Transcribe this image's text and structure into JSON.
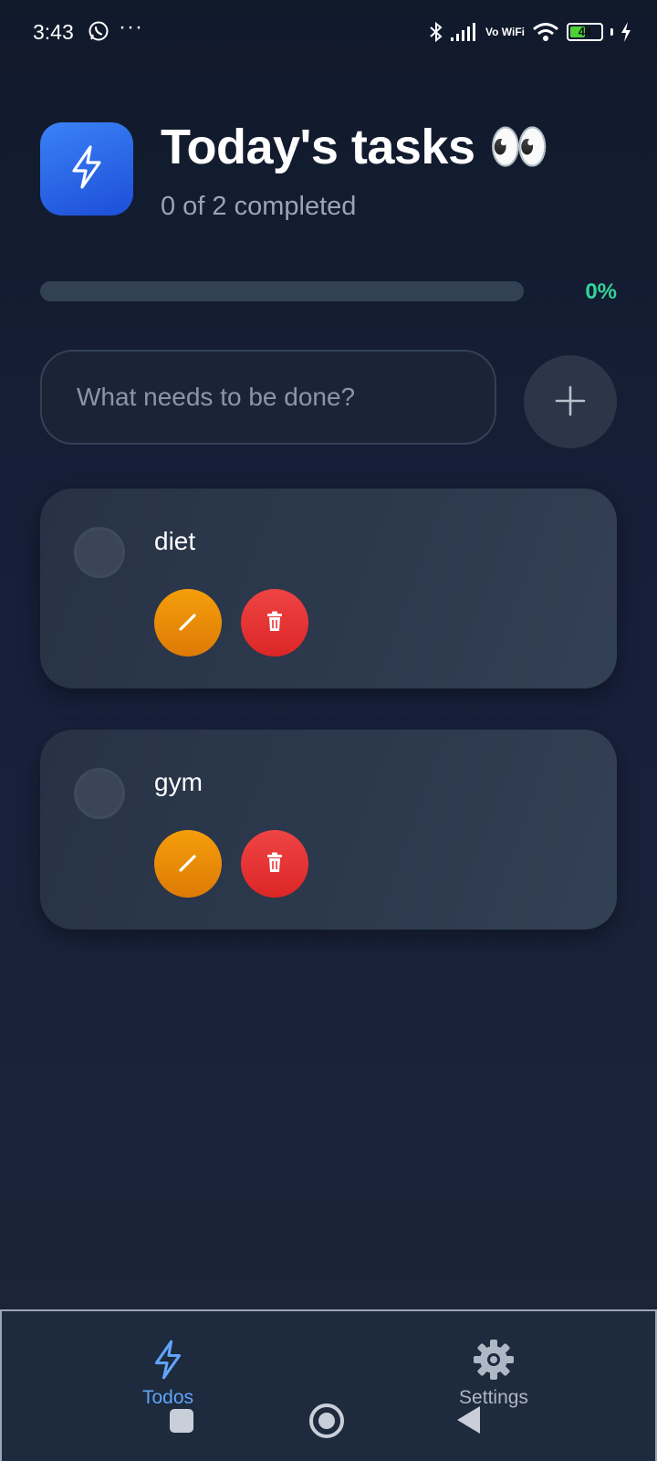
{
  "status_bar": {
    "time": "3:43",
    "battery_level": "44",
    "network_label": "Vo WiFi",
    "icons": [
      "whatsapp-icon",
      "more-dots-icon",
      "bluetooth-icon",
      "signal-icon",
      "wifi-icon",
      "battery-icon",
      "charging-icon"
    ]
  },
  "header": {
    "logo_icon": "lightning-icon",
    "title": "Today's tasks 👀",
    "subtitle": "0 of 2 completed"
  },
  "progress": {
    "value": 0,
    "label": "0%",
    "color": "#34d399"
  },
  "new_task": {
    "placeholder": "What needs to be done?",
    "value": "",
    "add_icon": "plus-icon"
  },
  "tasks": [
    {
      "title": "diet",
      "completed": false
    },
    {
      "title": "gym",
      "completed": false
    }
  ],
  "task_actions": {
    "edit_icon": "pencil-icon",
    "edit_color": "#f59e0b",
    "delete_icon": "trash-icon",
    "delete_color": "#ef4444"
  },
  "bottom_nav": {
    "items": [
      {
        "label": "Todos",
        "icon": "lightning-icon",
        "active": true
      },
      {
        "label": "Settings",
        "icon": "gear-icon",
        "active": false
      }
    ],
    "active_color": "#60a5fa"
  },
  "colors": {
    "background": "#111a2b",
    "accent": "#3b82f6",
    "card": "#2d3a4e"
  }
}
